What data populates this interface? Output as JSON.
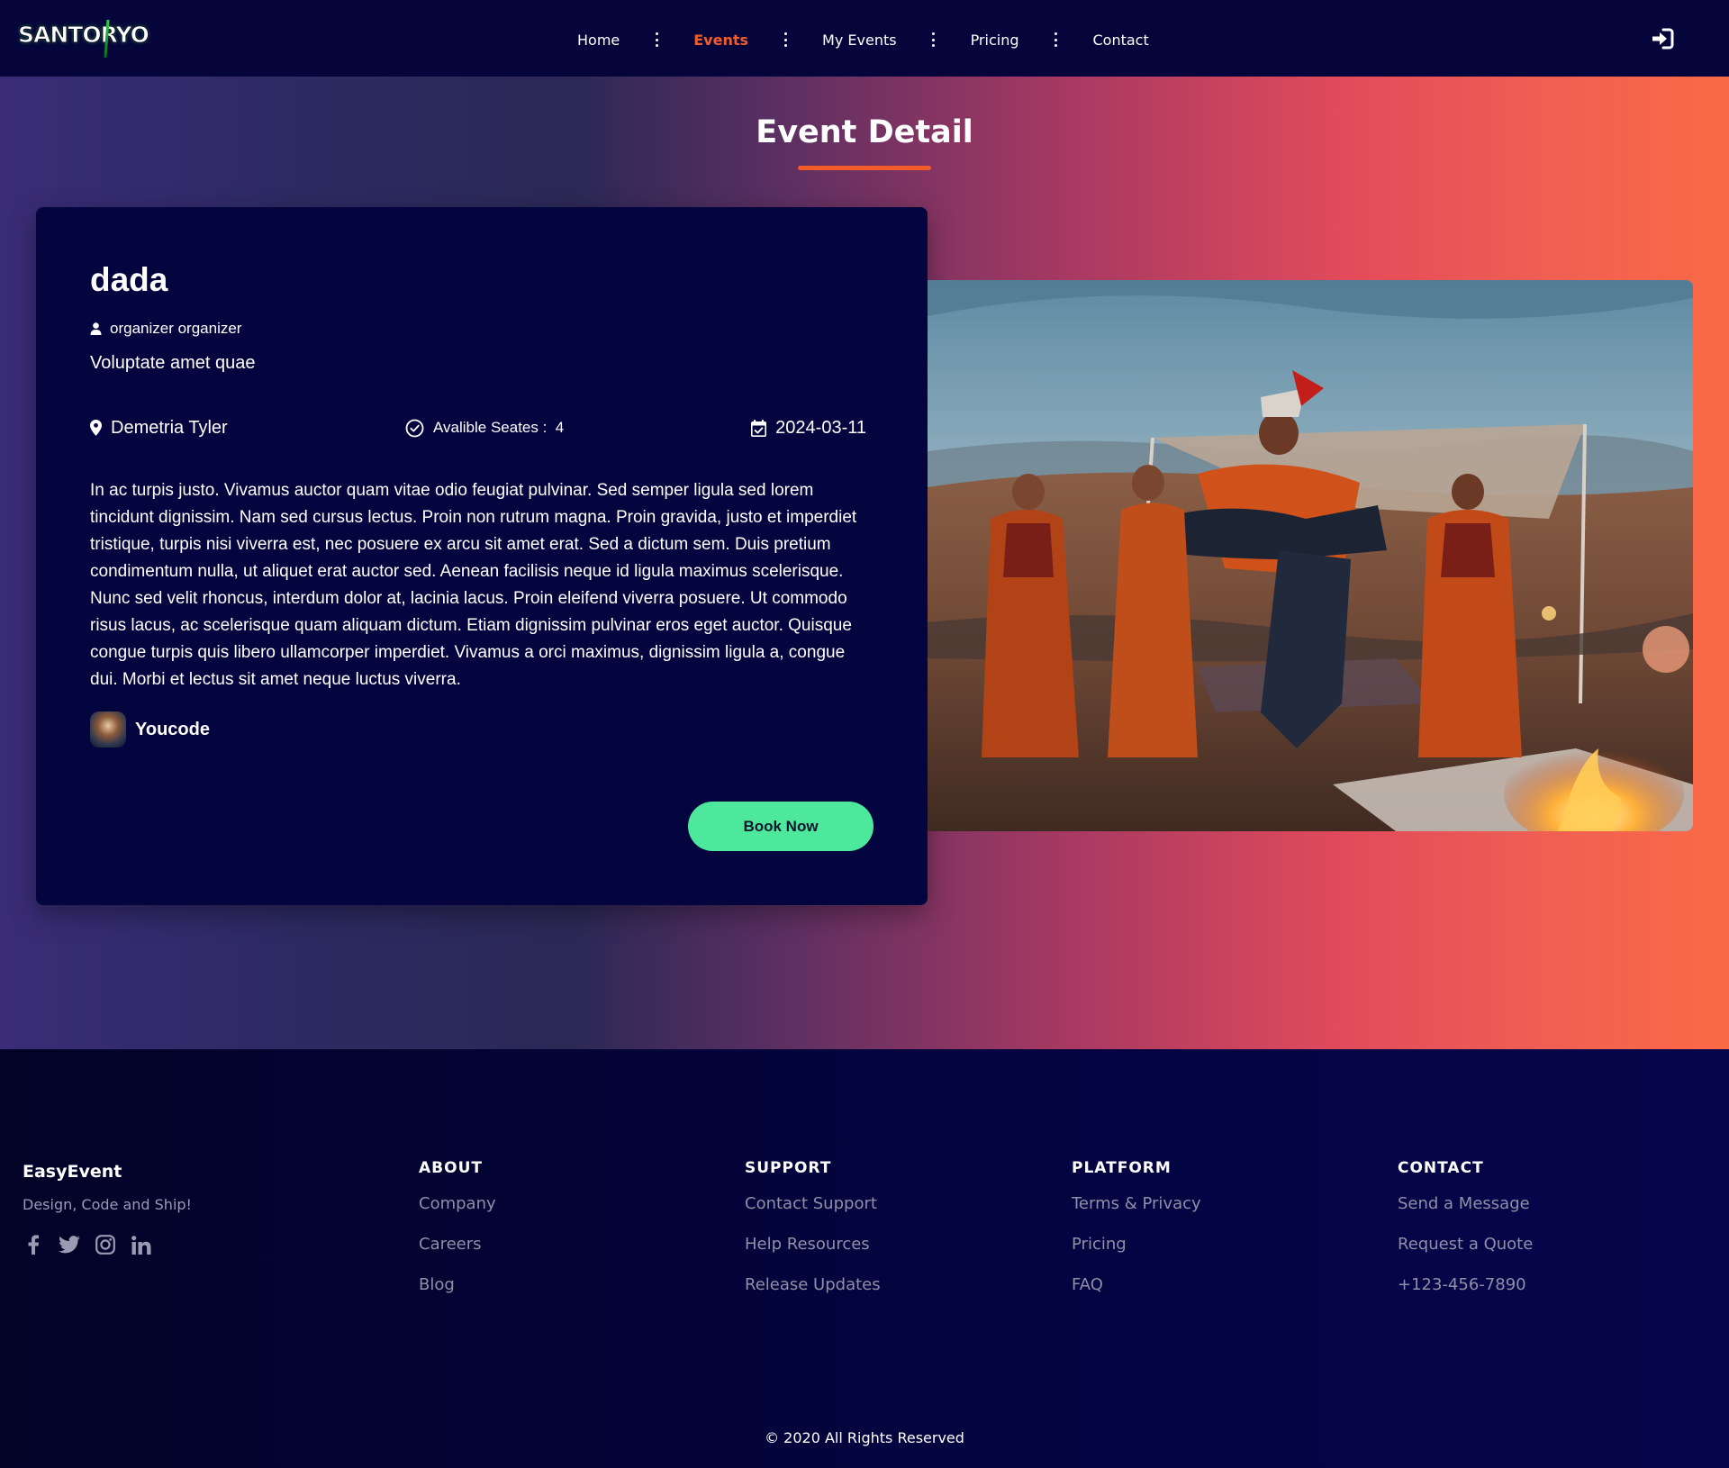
{
  "nav": {
    "logo_text": "SANTORYO",
    "links": [
      "Home",
      "Events",
      "My Events",
      "Pricing",
      "Contact"
    ],
    "active": "Events"
  },
  "hero": {
    "title": "Event Detail"
  },
  "event": {
    "title": "dada",
    "organizer": "organizer organizer",
    "subtitle": "Voluptate amet quae",
    "location": "Demetria Tyler",
    "seats_label": "Avalible Seates :",
    "seats_value": "4",
    "date": "2024-03-11",
    "description": "In ac turpis justo. Vivamus auctor quam vitae odio feugiat pulvinar. Sed semper ligula sed lorem tincidunt dignissim. Nam sed cursus lectus. Proin non rutrum magna. Proin gravida, justo et imperdiet tristique, turpis nisi viverra est, nec posuere ex arcu sit amet erat. Sed a dictum sem. Duis pretium condimentum nulla, ut aliquet erat auctor sed. Aenean facilisis neque id ligula maximus scelerisque. Nunc sed velit rhoncus, interdum dolor at, lacinia lacus. Proin eleifend viverra posuere. Ut commodo risus lacus, ac scelerisque quam aliquam dictum. Etiam dignissim pulvinar eros eget auctor. Quisque congue turpis quis libero ullamcorper imperdiet. Vivamus a orci maximus, dignissim ligula a, congue dui. Morbi et lectus sit amet neque luctus viverra.",
    "author": "Youcode",
    "book_label": "Book Now"
  },
  "footer": {
    "brand": "EasyEvent",
    "tagline": "Design, Code and Ship!",
    "columns": [
      {
        "title": "ABOUT",
        "links": [
          "Company",
          "Careers",
          "Blog"
        ]
      },
      {
        "title": "SUPPORT",
        "links": [
          "Contact Support",
          "Help Resources",
          "Release Updates"
        ]
      },
      {
        "title": "PLATFORM",
        "links": [
          "Terms & Privacy",
          "Pricing",
          "FAQ"
        ]
      },
      {
        "title": "CONTACT",
        "links": [
          "Send a Message",
          "Request a Quote",
          "+123-456-7890"
        ]
      }
    ],
    "socials": [
      "facebook-icon",
      "twitter-icon",
      "instagram-icon",
      "linkedin-icon"
    ],
    "copyright": "© 2020 All Rights Reserved"
  },
  "colors": {
    "accent": "#f25c2a",
    "button": "#4de89c",
    "navy": "#04043e"
  }
}
